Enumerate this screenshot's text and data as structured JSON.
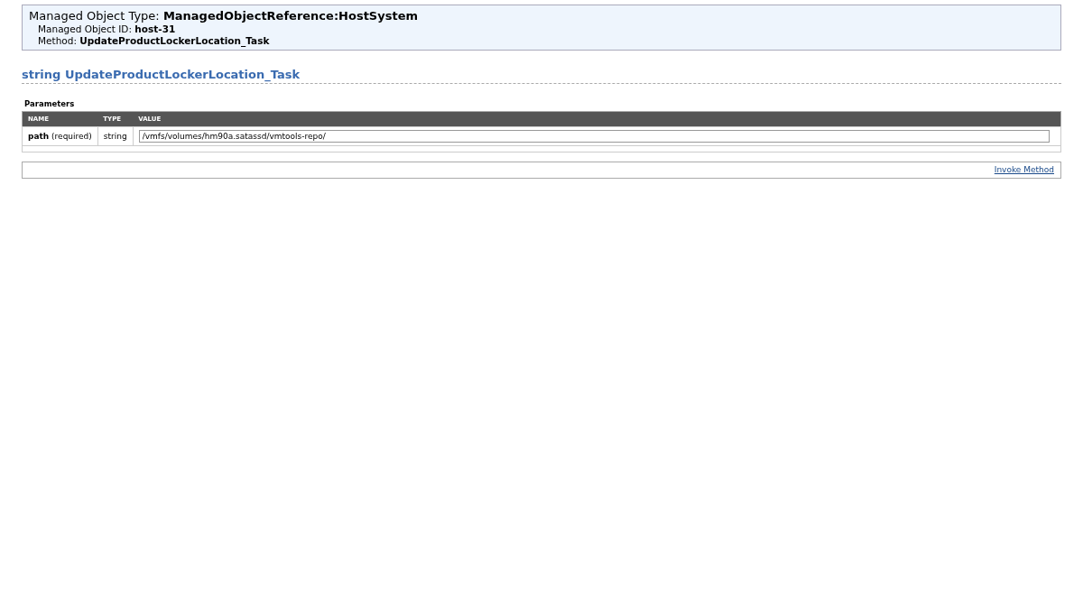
{
  "header": {
    "type_line": "Managed Object Type: **ManagedObjectReference:HostSystem**",
    "id_line": "Managed Object ID: **host-31**",
    "method_line": "Method: **UpdateProductLockerLocation_Task**"
  },
  "method_title": "string UpdateProductLockerLocation_Task",
  "parameters": {
    "title": "Parameters",
    "columns": [
      "NAME",
      "TYPE",
      "VALUE"
    ],
    "rows": [
      {
        "name": "path",
        "note": "(required)",
        "type": "string",
        "value": "/vmfs/volumes/hm90a.satassd/vmtools-repo/"
      }
    ]
  },
  "invoke_link": "Invoke Method"
}
